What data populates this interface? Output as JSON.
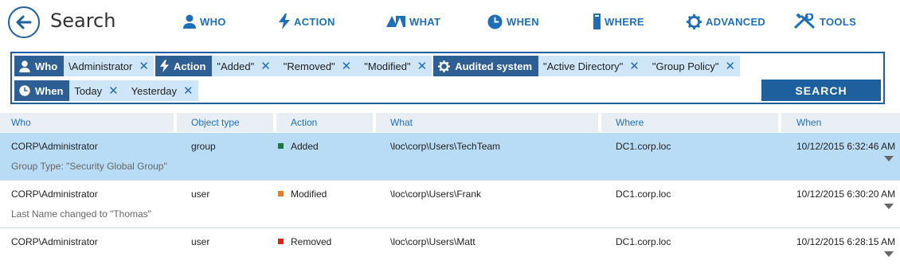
{
  "header": {
    "title": "Search",
    "nav": [
      {
        "label": "WHO",
        "icon": "user-icon"
      },
      {
        "label": "ACTION",
        "icon": "lightning-icon"
      },
      {
        "label": "WHAT",
        "icon": "shapes-icon"
      },
      {
        "label": "WHEN",
        "icon": "clock-icon"
      },
      {
        "label": "WHERE",
        "icon": "server-icon"
      },
      {
        "label": "ADVANCED",
        "icon": "gear-icon"
      },
      {
        "label": "TOOLS",
        "icon": "tools-icon"
      }
    ]
  },
  "filters": {
    "who": {
      "label": "Who",
      "values": [
        "\\Administrator"
      ]
    },
    "action": {
      "label": "Action",
      "values": [
        "\"Added\"",
        "\"Removed\"",
        "\"Modified\""
      ]
    },
    "audited": {
      "label": "Audited system",
      "values": [
        "\"Active Directory\"",
        "\"Group Policy\""
      ]
    },
    "when": {
      "label": "When",
      "values": [
        "Today",
        "Yesterday"
      ]
    },
    "remove_glyph": "✕",
    "search_label": "SEARCH"
  },
  "table": {
    "columns": [
      "Who",
      "Object type",
      "Action",
      "What",
      "Where",
      "When"
    ],
    "rows": [
      {
        "who": "CORP\\Administrator",
        "object_type": "group",
        "action": "Added",
        "action_color": "#1a7a3a",
        "what": "\\loc\\corp\\Users\\TechTeam",
        "where": "DC1.corp.loc",
        "when": "10/12/2015 6:32:46 AM",
        "detail": "Group Type: \"Security Global Group\"",
        "selected": true
      },
      {
        "who": "CORP\\Administrator",
        "object_type": "user",
        "action": "Modified",
        "action_color": "#f07b1e",
        "what": "\\loc\\corp\\Users\\Frank",
        "where": "DC1.corp.loc",
        "when": "10/12/2015 6:30:20 AM",
        "detail": "Last Name changed to \"Thomas\"",
        "selected": false
      },
      {
        "who": "CORP\\Administrator",
        "object_type": "user",
        "action": "Removed",
        "action_color": "#e0201b",
        "what": "\\loc\\corp\\Users\\Matt",
        "where": "DC1.corp.loc",
        "when": "10/12/2015 6:28:15 AM",
        "detail": "",
        "selected": false
      }
    ]
  },
  "colors": {
    "accent": "#1e5f9e",
    "link": "#1e6fb8",
    "selected_row": "#b9dcf6",
    "filter_value_bg": "#cfe6f8"
  }
}
